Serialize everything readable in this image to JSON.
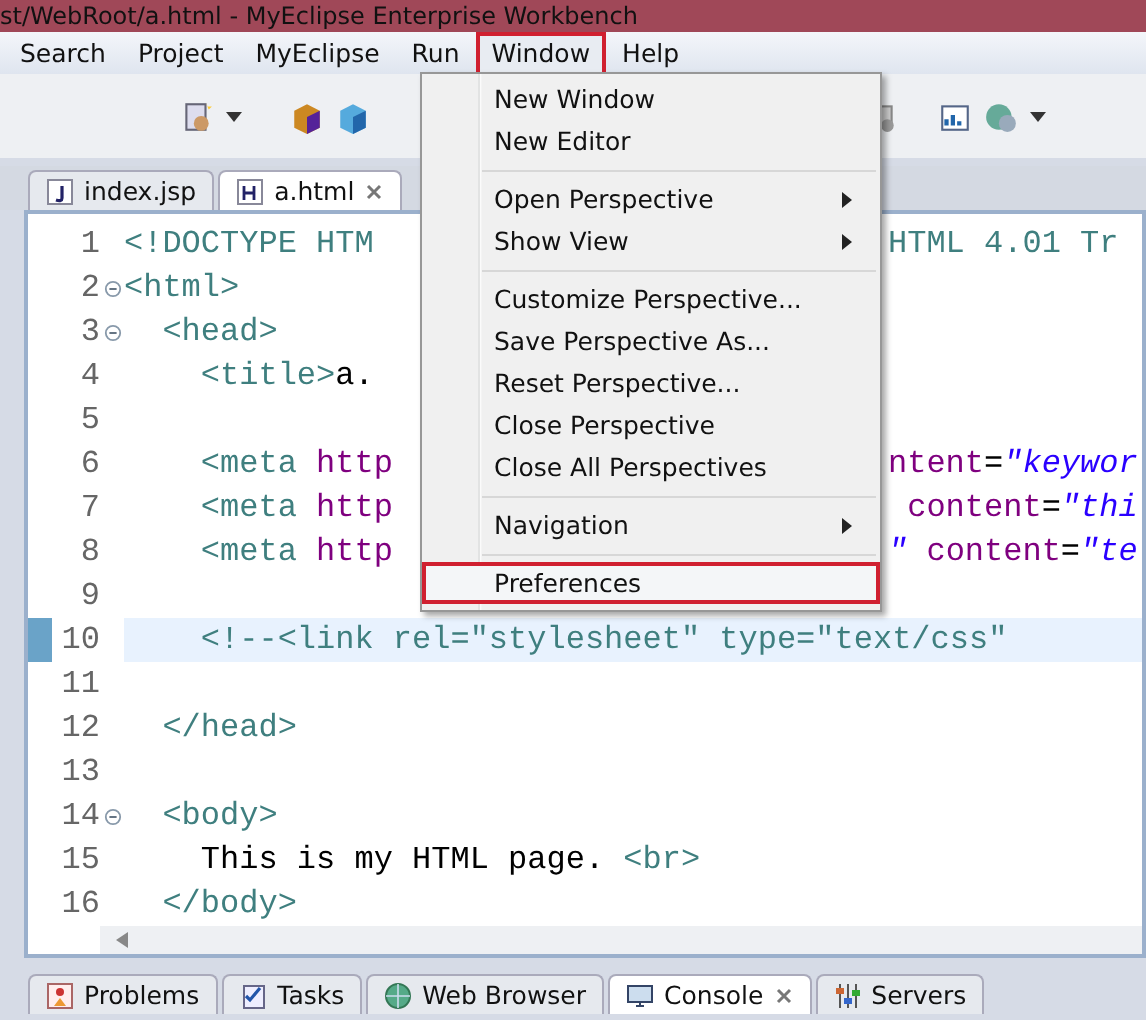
{
  "window": {
    "title": "st/WebRoot/a.html - MyEclipse Enterprise Workbench"
  },
  "menu_bar": [
    {
      "label": "Search",
      "selected": false
    },
    {
      "label": "Project",
      "selected": false
    },
    {
      "label": "MyEclipse",
      "selected": false
    },
    {
      "label": "Run",
      "selected": false
    },
    {
      "label": "Window",
      "selected": true
    },
    {
      "label": "Help",
      "selected": false
    }
  ],
  "window_menu": [
    {
      "kind": "item",
      "label": "New Window",
      "submenu": false,
      "selected": false
    },
    {
      "kind": "item",
      "label": "New Editor",
      "submenu": false,
      "selected": false
    },
    {
      "kind": "separator"
    },
    {
      "kind": "item",
      "label": "Open Perspective",
      "submenu": true,
      "selected": false
    },
    {
      "kind": "item",
      "label": "Show View",
      "submenu": true,
      "selected": false
    },
    {
      "kind": "separator"
    },
    {
      "kind": "item",
      "label": "Customize Perspective...",
      "submenu": false,
      "selected": false
    },
    {
      "kind": "item",
      "label": "Save Perspective As...",
      "submenu": false,
      "selected": false
    },
    {
      "kind": "item",
      "label": "Reset Perspective...",
      "submenu": false,
      "selected": false
    },
    {
      "kind": "item",
      "label": "Close Perspective",
      "submenu": false,
      "selected": false
    },
    {
      "kind": "item",
      "label": "Close All Perspectives",
      "submenu": false,
      "selected": false
    },
    {
      "kind": "separator"
    },
    {
      "kind": "item",
      "label": "Navigation",
      "submenu": true,
      "selected": false
    },
    {
      "kind": "separator"
    },
    {
      "kind": "item",
      "label": "Preferences",
      "submenu": false,
      "selected": true
    }
  ],
  "editor_tabs": [
    {
      "label": "index.jsp",
      "selected": false,
      "closable": false
    },
    {
      "label": "a.html",
      "selected": true,
      "closable": true
    }
  ],
  "code_lines": [
    {
      "number": "1",
      "fold": false,
      "current": false,
      "segments": [
        {
          "kind": "tag",
          "text": "<!DOCTYPE HTM"
        }
      ],
      "right": [
        {
          "kind": "tag",
          "text": "HTML 4.01 Tr"
        }
      ]
    },
    {
      "number": "2",
      "fold": true,
      "current": false,
      "segments": [
        {
          "kind": "tag",
          "text": "<html>"
        }
      ]
    },
    {
      "number": "3",
      "fold": true,
      "current": false,
      "segments": [
        {
          "kind": "tag",
          "text": "  <head>"
        }
      ]
    },
    {
      "number": "4",
      "fold": false,
      "current": false,
      "segments": [
        {
          "kind": "tag",
          "text": "    <title>"
        },
        {
          "kind": "text",
          "text": "a."
        }
      ]
    },
    {
      "number": "5",
      "fold": false,
      "current": false
    },
    {
      "number": "6",
      "fold": false,
      "current": false,
      "segments": [
        {
          "kind": "tag",
          "text": "    <meta "
        },
        {
          "kind": "attr",
          "text": "http"
        }
      ],
      "right": [
        {
          "kind": "attr",
          "text": "ntent"
        },
        {
          "kind": "text",
          "text": "="
        },
        {
          "kind": "string",
          "text": "\"keywor"
        }
      ]
    },
    {
      "number": "7",
      "fold": false,
      "current": false,
      "segments": [
        {
          "kind": "tag",
          "text": "    <meta "
        },
        {
          "kind": "attr",
          "text": "http"
        }
      ],
      "right": [
        {
          "kind": "attr",
          "text": " content"
        },
        {
          "kind": "text",
          "text": "="
        },
        {
          "kind": "string",
          "text": "\"thi"
        }
      ]
    },
    {
      "number": "8",
      "fold": false,
      "current": false,
      "segments": [
        {
          "kind": "tag",
          "text": "    <meta "
        },
        {
          "kind": "attr",
          "text": "http"
        }
      ],
      "right": [
        {
          "kind": "string",
          "text": "\""
        },
        {
          "kind": "attr",
          "text": " content"
        },
        {
          "kind": "text",
          "text": "="
        },
        {
          "kind": "string",
          "text": "\"te"
        }
      ]
    },
    {
      "number": "9",
      "fold": false,
      "current": false
    },
    {
      "number": "10",
      "fold": false,
      "current": true,
      "segments": [
        {
          "kind": "comment",
          "text": "    <!--<link rel=\"stylesheet\" type=\"text/css\""
        }
      ]
    },
    {
      "number": "11",
      "fold": false,
      "current": false
    },
    {
      "number": "12",
      "fold": false,
      "current": false,
      "segments": [
        {
          "kind": "tag",
          "text": "  </head>"
        }
      ]
    },
    {
      "number": "13",
      "fold": false,
      "current": false
    },
    {
      "number": "14",
      "fold": true,
      "current": false,
      "segments": [
        {
          "kind": "tag",
          "text": "  <body>"
        }
      ]
    },
    {
      "number": "15",
      "fold": false,
      "current": false,
      "segments": [
        {
          "kind": "text",
          "text": "    This is my HTML page. "
        },
        {
          "kind": "tag",
          "text": "<br>"
        }
      ]
    },
    {
      "number": "16",
      "fold": false,
      "current": false,
      "segments": [
        {
          "kind": "tag",
          "text": "  </body>"
        }
      ]
    }
  ],
  "panel_tabs": [
    {
      "label": "Problems",
      "selected": false,
      "closable": false
    },
    {
      "label": "Tasks",
      "selected": false,
      "closable": false
    },
    {
      "label": "Web Browser",
      "selected": false,
      "closable": false
    },
    {
      "label": "Console",
      "selected": true,
      "closable": true
    },
    {
      "label": "Servers",
      "selected": false,
      "closable": false
    }
  ]
}
